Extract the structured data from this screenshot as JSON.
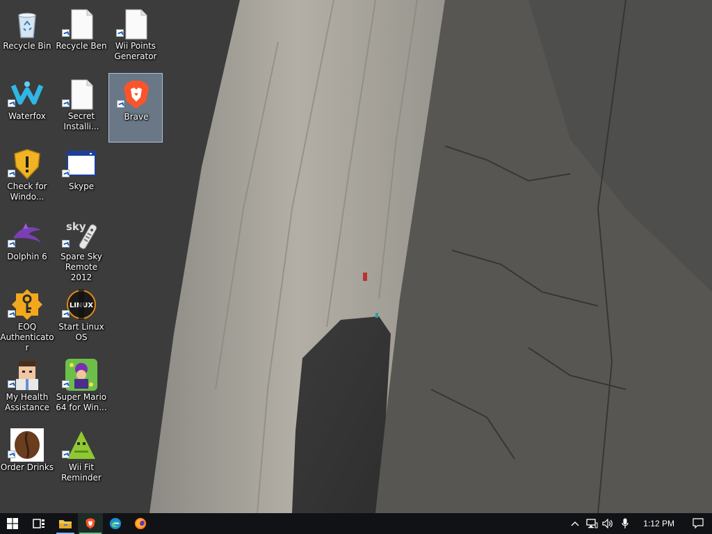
{
  "desktop": {
    "icons": [
      {
        "label": "Recycle Bin",
        "name": "recycle-bin-icon"
      },
      {
        "label": "Recycle Ben",
        "name": "file-shortcut-icon"
      },
      {
        "label": "Wii Points\nGenerator",
        "name": "file-shortcut-icon"
      },
      {
        "label": "Waterfox",
        "name": "waterfox-icon"
      },
      {
        "label": "Secret\nInstalli...",
        "name": "file-shortcut-icon"
      },
      {
        "label": "Brave",
        "name": "brave-icon"
      },
      {
        "label": "Check for\nWindo...",
        "name": "shield-warning-icon"
      },
      {
        "label": "Skype",
        "name": "window-app-icon"
      },
      {
        "label": "Dolphin 6",
        "name": "dolphin-icon"
      },
      {
        "label": "Spare Sky\nRemote 2012",
        "name": "sky-remote-icon"
      },
      {
        "label": "EOQ\nAuthenticator",
        "name": "key-icon"
      },
      {
        "label": "Start Linux\nOS",
        "name": "linux-icon"
      },
      {
        "label": "My Health\nAssistance",
        "name": "doctor-avatar-icon"
      },
      {
        "label": "Super Mario\n64 for Win...",
        "name": "mario-game-icon"
      },
      {
        "label": "Order Drinks",
        "name": "coffee-bean-icon"
      },
      {
        "label": "Wii Fit\nReminder",
        "name": "wii-fit-icon"
      }
    ],
    "selected": "Brave"
  },
  "taskbar": {
    "buttons": [
      {
        "name": "start-button",
        "icon": "windows-logo-icon"
      },
      {
        "name": "task-view-button",
        "icon": "task-view-icon"
      },
      {
        "name": "file-explorer-button",
        "icon": "folder-icon"
      },
      {
        "name": "brave-taskbar-button",
        "icon": "brave-icon"
      },
      {
        "name": "edge-taskbar-button",
        "icon": "edge-icon"
      },
      {
        "name": "firefox-taskbar-button",
        "icon": "firefox-icon"
      }
    ],
    "tray": {
      "icons": [
        "chevron-up-icon",
        "network-icon",
        "volume-icon",
        "microphone-icon"
      ],
      "clock": "1:12 PM",
      "notification_icon": "notification-icon"
    }
  },
  "colors": {
    "taskbar": "#101215",
    "selection": "#a0bee1",
    "brave_orange": "#fb542b",
    "accent_blue": "#7fb6ff"
  }
}
